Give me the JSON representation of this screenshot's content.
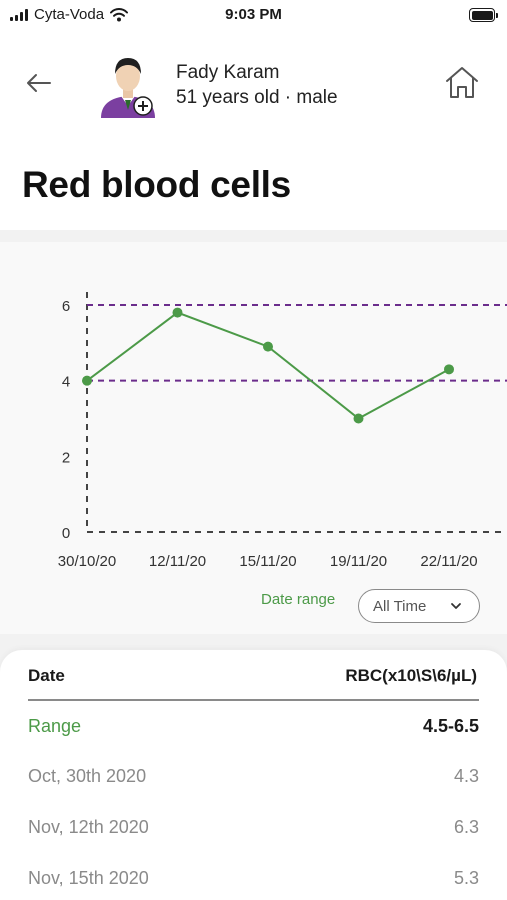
{
  "status_bar": {
    "carrier": "Cyta-Voda",
    "time": "9:03 PM"
  },
  "patient": {
    "name": "Fady Karam",
    "info": "51 years old · male"
  },
  "page": {
    "title": "Red blood cells"
  },
  "chart_data": {
    "type": "line",
    "x": [
      "30/10/20",
      "12/11/20",
      "15/11/20",
      "19/11/20",
      "22/11/20"
    ],
    "values": [
      4.0,
      5.8,
      4.9,
      3.0,
      4.3
    ],
    "ylim": [
      0,
      6
    ],
    "yticks": [
      0,
      2,
      4,
      6
    ],
    "reference_lines": [
      4,
      6
    ],
    "title": "",
    "xlabel": "",
    "ylabel": "",
    "line_color": "#4c9a48",
    "reference_color": "#6b2d8c"
  },
  "filter": {
    "label": "Date range",
    "value": "All Time"
  },
  "table": {
    "headers": {
      "date": "Date",
      "value": "RBC(x10\\S\\6/µL)"
    },
    "range_row": {
      "label": "Range",
      "value": "4.5-6.5"
    },
    "rows": [
      {
        "date": "Oct, 30th 2020",
        "value": "4.3"
      },
      {
        "date": "Nov, 12th 2020",
        "value": "6.3"
      },
      {
        "date": "Nov, 15th 2020",
        "value": "5.3"
      }
    ]
  },
  "colors": {
    "accent_green": "#4c9a48",
    "avatar_purple": "#7b3fa0"
  }
}
